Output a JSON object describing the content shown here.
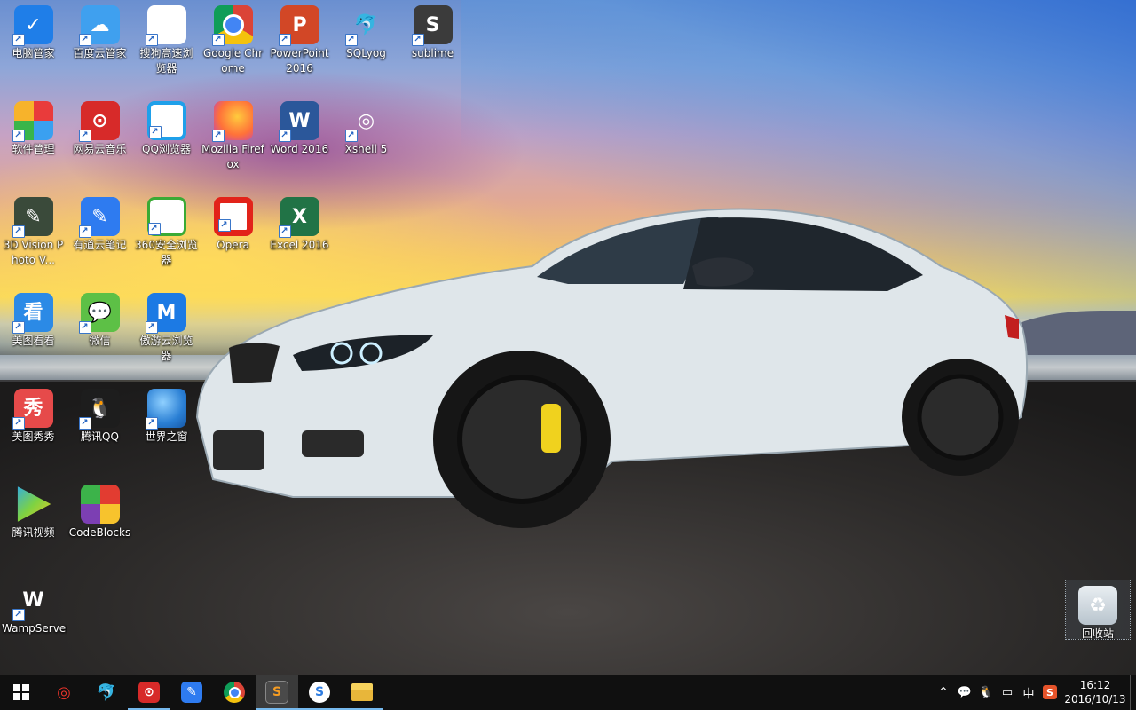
{
  "desktop": {
    "icons": [
      {
        "label": "电脑管家",
        "glyph": "✓"
      },
      {
        "label": "百度云管家",
        "glyph": "☁"
      },
      {
        "label": "搜狗高速浏览器",
        "glyph": "S"
      },
      {
        "label": "Google Chrome",
        "glyph": ""
      },
      {
        "label": "PowerPoint 2016",
        "glyph": "P"
      },
      {
        "label": "SQLyog",
        "glyph": "🐬"
      },
      {
        "label": "sublime",
        "glyph": "S"
      },
      {
        "label": "软件管理",
        "glyph": ""
      },
      {
        "label": "网易云音乐",
        "glyph": "⊙"
      },
      {
        "label": "QQ浏览器",
        "glyph": "Q"
      },
      {
        "label": "Mozilla Firefox",
        "glyph": ""
      },
      {
        "label": "Word 2016",
        "glyph": "W"
      },
      {
        "label": "Xshell 5",
        "glyph": "◎"
      },
      {
        "label": "3D Vision Photo V...",
        "glyph": "✎"
      },
      {
        "label": "有道云笔记",
        "glyph": "✎"
      },
      {
        "label": "360安全浏览器",
        "glyph": "e"
      },
      {
        "label": "Opera",
        "glyph": ""
      },
      {
        "label": "Excel 2016",
        "glyph": "X"
      },
      {
        "label": "美图看看",
        "glyph": "看"
      },
      {
        "label": "微信",
        "glyph": "💬"
      },
      {
        "label": "傲游云浏览器",
        "glyph": "M"
      },
      {
        "label": "美图秀秀",
        "glyph": "秀"
      },
      {
        "label": "腾讯QQ",
        "glyph": "🐧"
      },
      {
        "label": "世界之窗",
        "glyph": ""
      },
      {
        "label": "腾讯视频",
        "glyph": ""
      },
      {
        "label": "CodeBlocks",
        "glyph": ""
      },
      {
        "label": "WampServer",
        "glyph": "W"
      }
    ],
    "recycle_bin": {
      "label": "回收站",
      "glyph": "♻"
    }
  },
  "taskbar": {
    "pinned": [
      {
        "name": "xshell",
        "glyph": "◎"
      },
      {
        "name": "sqlyog",
        "glyph": "🐬"
      },
      {
        "name": "netease-music",
        "glyph": "⊙"
      },
      {
        "name": "youdao-note",
        "glyph": "✎"
      },
      {
        "name": "chrome",
        "glyph": ""
      },
      {
        "name": "sublime",
        "glyph": "S"
      },
      {
        "name": "sogou-browser",
        "glyph": "S"
      },
      {
        "name": "file-explorer",
        "glyph": ""
      }
    ],
    "tray": {
      "chevron": "^",
      "wechat": "💬",
      "qq": "🐧",
      "notifications": "▭",
      "ime": "中",
      "sogou_ime": "S",
      "time": "16:12",
      "date": "2016/10/13"
    }
  }
}
